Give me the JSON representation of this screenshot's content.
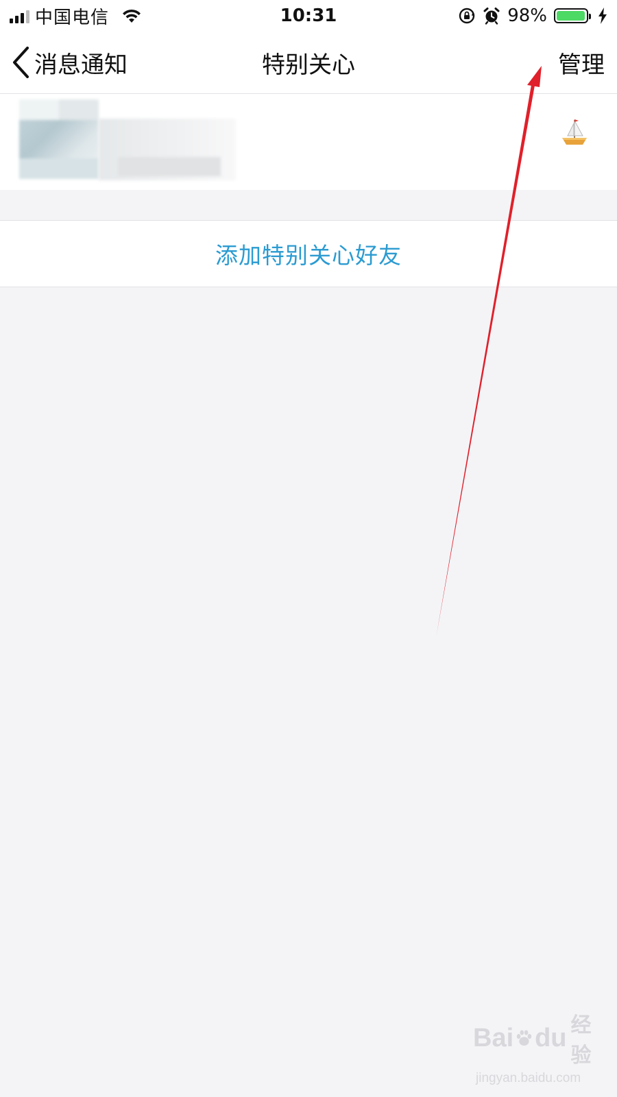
{
  "status_bar": {
    "carrier": "中国电信",
    "time": "10:31",
    "battery_percent": "98%",
    "battery_level": 0.98,
    "icons": [
      "signal-icon",
      "wifi-icon",
      "orientation-lock-icon",
      "alarm-icon",
      "battery-icon",
      "charging-icon"
    ]
  },
  "nav": {
    "back_label": "消息通知",
    "title": "特别关心",
    "manage_label": "管理"
  },
  "friends": [
    {
      "name": "",
      "badge_icon": "sailboat-icon"
    }
  ],
  "add_button": {
    "label": "添加特别关心好友"
  },
  "colors": {
    "background": "#f4f4f7",
    "accent": "#2b9bd1",
    "annotation": "#e0202a",
    "battery": "#4cd964"
  },
  "watermark": {
    "brand_latin": "Bai",
    "brand_latin_tail": "du",
    "brand_cn": "经验",
    "url": "jingyan.baidu.com"
  }
}
